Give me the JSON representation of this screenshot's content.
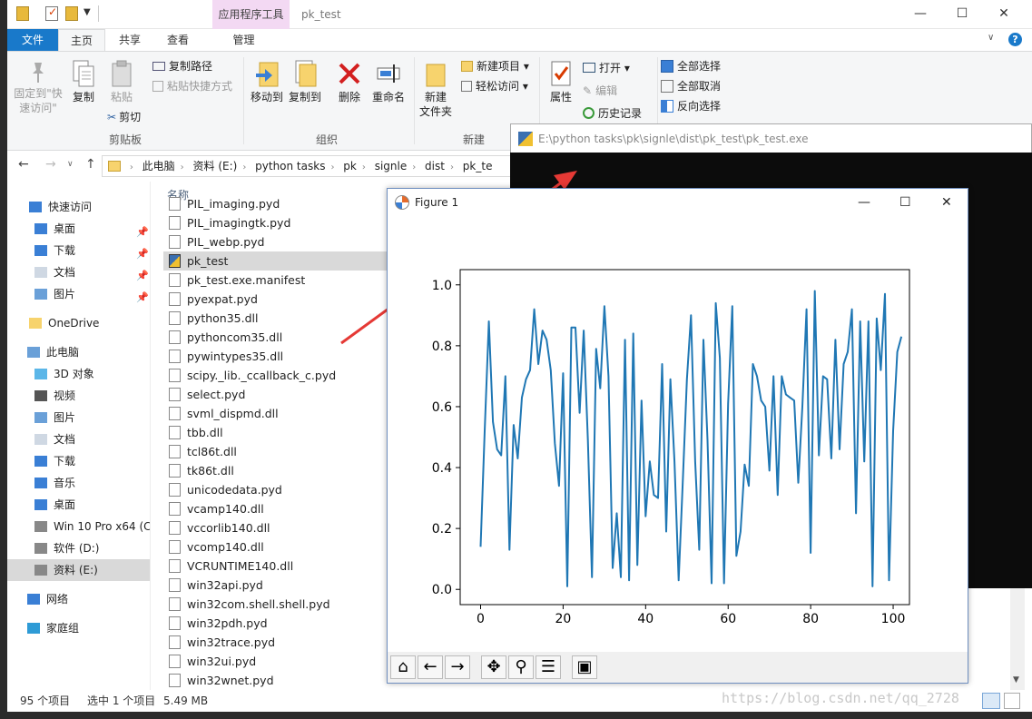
{
  "window": {
    "context_tab": "应用程序工具",
    "title": "pk_test",
    "minimize": "—",
    "maximize": "☐",
    "close": "✕"
  },
  "tabs": {
    "file": "文件",
    "home": "主页",
    "share": "共享",
    "view": "查看",
    "manage": "管理"
  },
  "ribbon": {
    "pin_quick": "固定到\"快\n速访问\"",
    "copy": "复制",
    "paste": "粘贴",
    "copy_path": "复制路径",
    "paste_shortcut": "粘贴快捷方式",
    "cut": "剪切",
    "group_clipboard": "剪贴板",
    "move_to": "移动到",
    "copy_to": "复制到",
    "delete": "删除",
    "rename": "重命名",
    "group_organize": "组织",
    "new_folder": "新建\n文件夹",
    "new_item": "新建项目",
    "easy_access": "轻松访问",
    "group_new": "新建",
    "properties": "属性",
    "open": "打开",
    "edit": "编辑",
    "history": "历史记录",
    "select_all": "全部选择",
    "select_none": "全部取消",
    "invert_selection": "反向选择"
  },
  "address": {
    "crumbs": [
      "此电脑",
      "资料 (E:)",
      "python tasks",
      "pk",
      "signle",
      "dist",
      "pk_te"
    ]
  },
  "nav": {
    "items": [
      {
        "label": "快速访问",
        "icon": "star-icon",
        "pin": false
      },
      {
        "label": "桌面",
        "icon": "desktop-icon",
        "pin": true
      },
      {
        "label": "下载",
        "icon": "download-icon",
        "pin": true
      },
      {
        "label": "文档",
        "icon": "document-icon",
        "pin": true
      },
      {
        "label": "图片",
        "icon": "picture-icon",
        "pin": true
      },
      {
        "label": "OneDrive",
        "icon": "folder-icon",
        "pin": false
      },
      {
        "label": "此电脑",
        "icon": "computer-icon",
        "pin": false
      },
      {
        "label": "3D 对象",
        "icon": "cube-icon",
        "pin": false
      },
      {
        "label": "视频",
        "icon": "video-icon",
        "pin": false
      },
      {
        "label": "图片",
        "icon": "picture-icon",
        "pin": false
      },
      {
        "label": "文档",
        "icon": "document-icon",
        "pin": false
      },
      {
        "label": "下载",
        "icon": "download-icon",
        "pin": false
      },
      {
        "label": "音乐",
        "icon": "music-icon",
        "pin": false
      },
      {
        "label": "桌面",
        "icon": "desktop-icon",
        "pin": false
      },
      {
        "label": "Win 10 Pro x64 (C",
        "icon": "drive-icon",
        "pin": false
      },
      {
        "label": "软件 (D:)",
        "icon": "drive-icon",
        "pin": false
      },
      {
        "label": "资料 (E:)",
        "icon": "drive-icon",
        "pin": false
      },
      {
        "label": "网络",
        "icon": "network-icon",
        "pin": false
      },
      {
        "label": "家庭组",
        "icon": "homegroup-icon",
        "pin": false
      }
    ]
  },
  "filelist": {
    "column_name": "名称",
    "files": [
      "PIL_imaging.pyd",
      "PIL_imagingtk.pyd",
      "PIL_webp.pyd",
      "pk_test",
      "pk_test.exe.manifest",
      "pyexpat.pyd",
      "python35.dll",
      "pythoncom35.dll",
      "pywintypes35.dll",
      "scipy._lib._ccallback_c.pyd",
      "select.pyd",
      "svml_dispmd.dll",
      "tbb.dll",
      "tcl86t.dll",
      "tk86t.dll",
      "unicodedata.pyd",
      "vcamp140.dll",
      "vccorlib140.dll",
      "vcomp140.dll",
      "VCRUNTIME140.dll",
      "win32api.pyd",
      "win32com.shell.shell.pyd",
      "win32pdh.pyd",
      "win32trace.pyd",
      "win32ui.pyd",
      "win32wnet.pyd"
    ],
    "selected_index": 3
  },
  "status": {
    "count": "95 个项目",
    "selected": "选中 1 个项目",
    "size": "5.49 MB"
  },
  "console": {
    "title": "E:\\python tasks\\pk\\signle\\dist\\pk_test\\pk_test.exe"
  },
  "figure": {
    "title": "Figure 1",
    "toolbar": [
      "home-icon",
      "back-icon",
      "forward-icon",
      "pan-icon",
      "zoom-icon",
      "configure-icon",
      "save-icon"
    ]
  },
  "chart_data": {
    "type": "line",
    "color": "#1f77b4",
    "xlim": [
      0,
      99
    ],
    "ylim": [
      0,
      1
    ],
    "xticks": [
      0,
      20,
      40,
      60,
      80,
      100
    ],
    "yticks": [
      0.0,
      0.2,
      0.4,
      0.6,
      0.8,
      1.0
    ],
    "ytick_labels": [
      "0.0",
      "0.2",
      "0.4",
      "0.6",
      "0.8",
      "1.0"
    ],
    "values": [
      0.14,
      0.52,
      0.88,
      0.55,
      0.46,
      0.44,
      0.7,
      0.13,
      0.54,
      0.43,
      0.63,
      0.69,
      0.72,
      0.92,
      0.74,
      0.85,
      0.82,
      0.72,
      0.48,
      0.34,
      0.71,
      0.01,
      0.86,
      0.86,
      0.58,
      0.85,
      0.49,
      0.04,
      0.79,
      0.66,
      0.93,
      0.7,
      0.07,
      0.25,
      0.04,
      0.82,
      0.03,
      0.84,
      0.08,
      0.62,
      0.24,
      0.42,
      0.31,
      0.3,
      0.74,
      0.19,
      0.69,
      0.42,
      0.03,
      0.35,
      0.69,
      0.9,
      0.42,
      0.13,
      0.82,
      0.49,
      0.02,
      0.94,
      0.76,
      0.02,
      0.61,
      0.93,
      0.11,
      0.19,
      0.41,
      0.34,
      0.74,
      0.7,
      0.62,
      0.6,
      0.39,
      0.7,
      0.31,
      0.7,
      0.64,
      0.63,
      0.62,
      0.35,
      0.6,
      0.92,
      0.12,
      0.98,
      0.44,
      0.7,
      0.69,
      0.43,
      0.82,
      0.46,
      0.74,
      0.78,
      0.92,
      0.25,
      0.88,
      0.42,
      0.88,
      0.01,
      0.89,
      0.72,
      0.97,
      0.03,
      0.52,
      0.78,
      0.83
    ]
  },
  "watermark": "https://blog.csdn.net/qq_2728"
}
